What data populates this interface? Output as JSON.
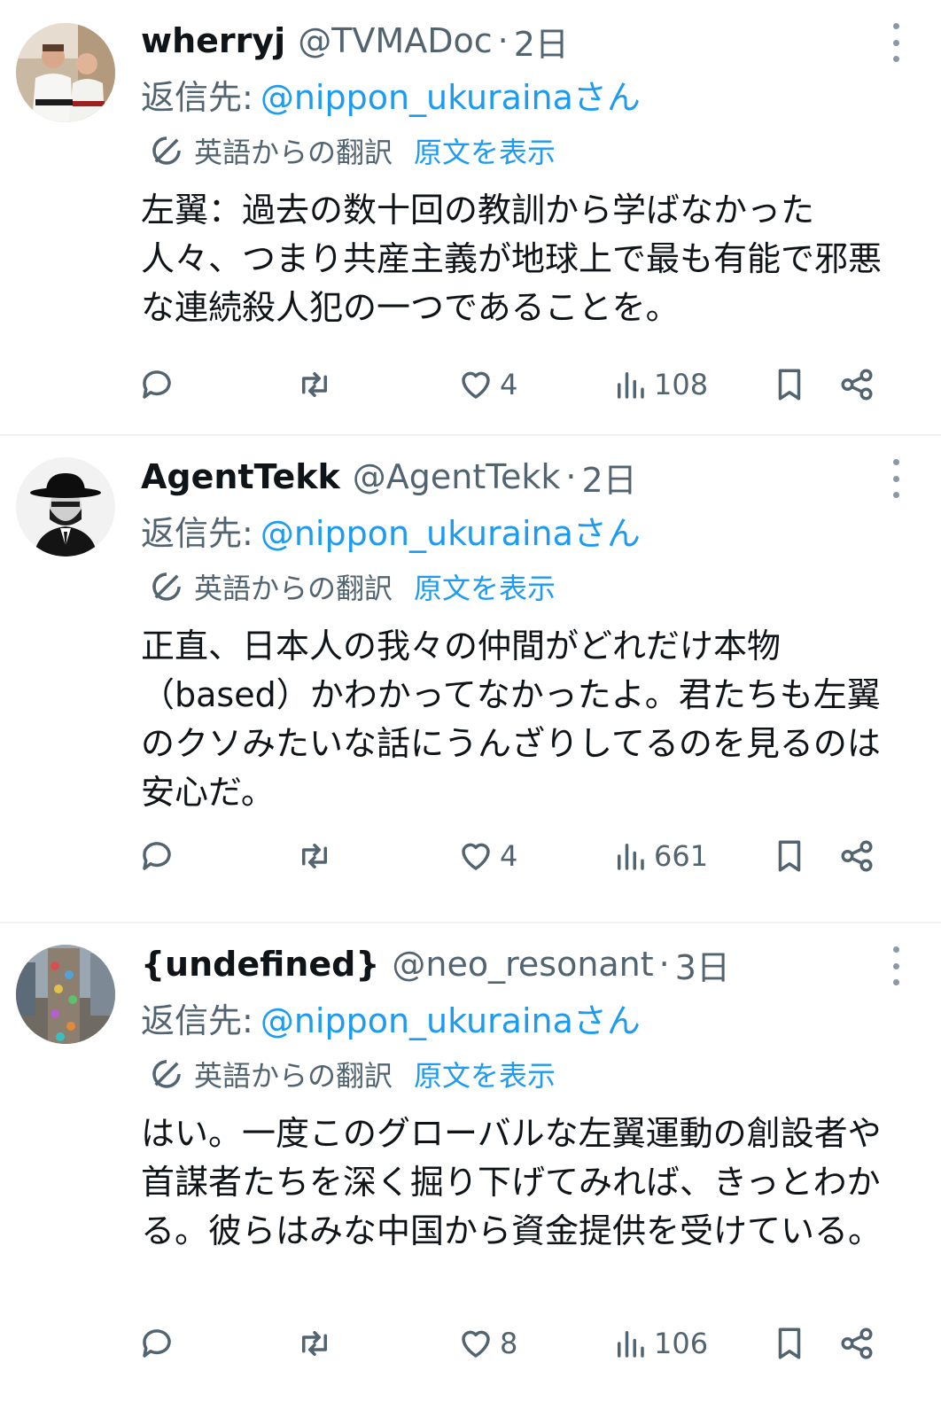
{
  "tweets": [
    {
      "display_name": "wherryj",
      "handle": "@TVMADoc",
      "separator": "·",
      "time": "2日",
      "reply_prefix": "返信先:",
      "reply_to": "@nippon_ukurainaさん",
      "translated_from": "英語からの翻訳",
      "show_original": "原文を表示",
      "text": "左翼：過去の数十回の教訓から学ばなかった人々、つまり共産主義が地球上で最も有能で邪悪な連続殺人犯の一つであることを。",
      "likes": "4",
      "views": "108"
    },
    {
      "display_name": "AgentTekk",
      "handle": "@AgentTekk",
      "separator": "·",
      "time": "2日",
      "reply_prefix": "返信先:",
      "reply_to": "@nippon_ukurainaさん",
      "translated_from": "英語からの翻訳",
      "show_original": "原文を表示",
      "text": "正直、日本人の我々の仲間がどれだけ本物（based）かわかってなかったよ。君たちも左翼のクソみたいな話にうんざりしてるのを見るのは安心だ。",
      "likes": "4",
      "views": "661"
    },
    {
      "display_name": "{undefined}",
      "handle": "@neo_resonant",
      "separator": "·",
      "time": "3日",
      "reply_prefix": "返信先:",
      "reply_to": "@nippon_ukurainaさん",
      "translated_from": "英語からの翻訳",
      "show_original": "原文を表示",
      "text": "はい。一度このグローバルな左翼運動の創設者や首謀者たちを深く掘り下げてみれば、きっとわかる。彼らはみな中国から資金提供を受けている。",
      "likes": "8",
      "views": "106"
    }
  ],
  "colors": {
    "link": "#1d9bf0",
    "secondary_text": "#536471",
    "primary_text": "#0f1419",
    "divider": "#eff3f4"
  },
  "icons": [
    "more-icon",
    "translate-icon",
    "reply-icon",
    "retweet-icon",
    "like-icon",
    "views-icon",
    "bookmark-icon",
    "share-icon"
  ]
}
